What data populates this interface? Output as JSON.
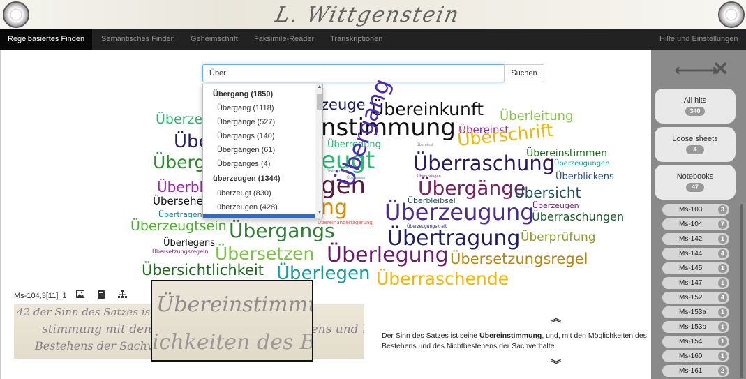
{
  "header": {
    "signature_text": "L. Wittgenstein"
  },
  "nav": {
    "items": [
      "Regelbasiertes Finden",
      "Semantisches Finden",
      "Geheimschrift",
      "Faksimile-Reader",
      "Transkriptionen"
    ],
    "help": "Hilfe und Einstellungen"
  },
  "search": {
    "value": "Über",
    "button": "Suchen"
  },
  "dropdown": {
    "items": [
      {
        "label": "Übergang (1850)",
        "group": true
      },
      {
        "label": "Übergang (1118)",
        "group": false
      },
      {
        "label": "Übergänge (527)",
        "group": false
      },
      {
        "label": "Übergangs (140)",
        "group": false
      },
      {
        "label": "Übergängen (61)",
        "group": false
      },
      {
        "label": "Überganges (4)",
        "group": false
      },
      {
        "label": "überzeugen (1344)",
        "group": true
      },
      {
        "label": "überzeugt (830)",
        "group": false
      },
      {
        "label": "überzeugen (428)",
        "group": false
      },
      {
        "label": "",
        "group": false,
        "selected": true
      }
    ]
  },
  "wordcloud": [
    {
      "text": "Überzeu",
      "color": "#2bb673"
    },
    {
      "text": "Übe",
      "color": "#1f1f5e"
    },
    {
      "text": "Überg",
      "color": "#2e8b2e"
    },
    {
      "text": "Überbl",
      "color": "#9b27b0"
    },
    {
      "text": "Übersehen",
      "color": "#111111"
    },
    {
      "text": "Übertragen",
      "color": "#1b8a8a"
    },
    {
      "text": "Überzeugtsein",
      "color": "#4caf2e"
    },
    {
      "text": "Überlegens",
      "color": "#111111"
    },
    {
      "text": "Übersetzungsregeln",
      "color": "#6a1b6a"
    },
    {
      "text": "Übersichtlichkeit",
      "color": "#1e6b1e"
    },
    {
      "text": "zeuge",
      "color": "#1f1f5e"
    },
    {
      "text": "nstimmung",
      "color": "#111111"
    },
    {
      "text": "Überredung",
      "color": "#2bb673"
    },
    {
      "text": "eugt",
      "color": "#2bb673"
    },
    {
      "text": "gen",
      "color": "#5a1a3a"
    },
    {
      "text": "ng",
      "color": "#d98c00"
    },
    {
      "text": "Übergangs",
      "color": "#2e7d32"
    },
    {
      "text": "Übersetzen",
      "color": "#7bc043"
    },
    {
      "text": "Überlegung",
      "color": "#6a1b6a"
    },
    {
      "text": "Überlegen",
      "color": "#1b9a9a"
    },
    {
      "text": "Übereinkunft",
      "color": "#111111"
    },
    {
      "text": "Überleitung",
      "color": "#8bc34a"
    },
    {
      "text": "Übereinst",
      "color": "#9c27b0"
    },
    {
      "text": "Überschrift",
      "color": "#f2b705"
    },
    {
      "text": "Übergang",
      "color": "#4b2bb0"
    },
    {
      "text": "Übereinstimmen",
      "color": "#1e6b1e"
    },
    {
      "text": "Überraschung",
      "color": "#2a1a5e"
    },
    {
      "text": "Überzeugungen",
      "color": "#1b9a9a"
    },
    {
      "text": "Überblickens",
      "color": "#1f4f8f"
    },
    {
      "text": "Übergänge",
      "color": "#7b1f5e"
    },
    {
      "text": "Übersicht",
      "color": "#1f4f5e"
    },
    {
      "text": "Überbleibsel",
      "color": "#1f4f5e"
    },
    {
      "text": "Überzeugung",
      "color": "#4b2b8b"
    },
    {
      "text": "Überzeugen",
      "color": "#6a1b6a"
    },
    {
      "text": "Überraschungen",
      "color": "#1e5e2e"
    },
    {
      "text": "Übertragung",
      "color": "#1f1f5e"
    },
    {
      "text": "Überprüfung",
      "color": "#8a9a2a"
    },
    {
      "text": "Übersetzungsregel",
      "color": "#b8860b"
    },
    {
      "text": "Überraschende",
      "color": "#f2b705"
    },
    {
      "text": "Übereinanderlagerung",
      "color": "#d9534f"
    },
    {
      "text": "Überzeugungskraft",
      "color": "#1f1f5e"
    },
    {
      "text": "Übersetzens",
      "color": "#777777"
    },
    {
      "text": "Überspringen",
      "color": "#8a3a8a"
    },
    {
      "text": "Übereinst",
      "color": "#777777"
    },
    {
      "text": "Überessen",
      "color": "#1b9a9a"
    }
  ],
  "viewer": {
    "label": "Ms-104,3[11]_1",
    "icons": [
      "image-icon",
      "book-icon",
      "sitemap-icon"
    ],
    "hand_lines": [
      "42 der Sinn des Satzes ist seine Übereinstimmung",
      "stimmung mit den Möglichkeiten des Bestehens und nicht",
      "Bestehens der Sachverhalte",
      "Übereinstimmung",
      "ichkeiten des Be"
    ],
    "transcript_before": "Der Sinn des Satzes ist seine ",
    "transcript_bold": "Übereinstimmung",
    "transcript_after": ", und, mit den Möglichkeiten des Bestehens und des Nichtbestehens der Sachverhalte."
  },
  "panel": {
    "all_hits": {
      "label": "All hits",
      "count": "340"
    },
    "loose_sheets": {
      "label": "Loose sheets",
      "count": "4"
    },
    "notebooks": {
      "label": "Notebooks",
      "count": "47"
    },
    "items": [
      {
        "label": "Ms-103",
        "count": "3"
      },
      {
        "label": "Ms-104",
        "count": "7"
      },
      {
        "label": "Ms-142",
        "count": "1"
      },
      {
        "label": "Ms-144",
        "count": "4"
      },
      {
        "label": "Ms-145",
        "count": "1"
      },
      {
        "label": "Ms-147",
        "count": "1"
      },
      {
        "label": "Ms-152",
        "count": "4"
      },
      {
        "label": "Ms-153a",
        "count": "1"
      },
      {
        "label": "Ms-153b",
        "count": "1"
      },
      {
        "label": "Ms-154",
        "count": "1"
      },
      {
        "label": "Ms-160",
        "count": "1"
      },
      {
        "label": "Ms-161",
        "count": "2"
      }
    ]
  }
}
